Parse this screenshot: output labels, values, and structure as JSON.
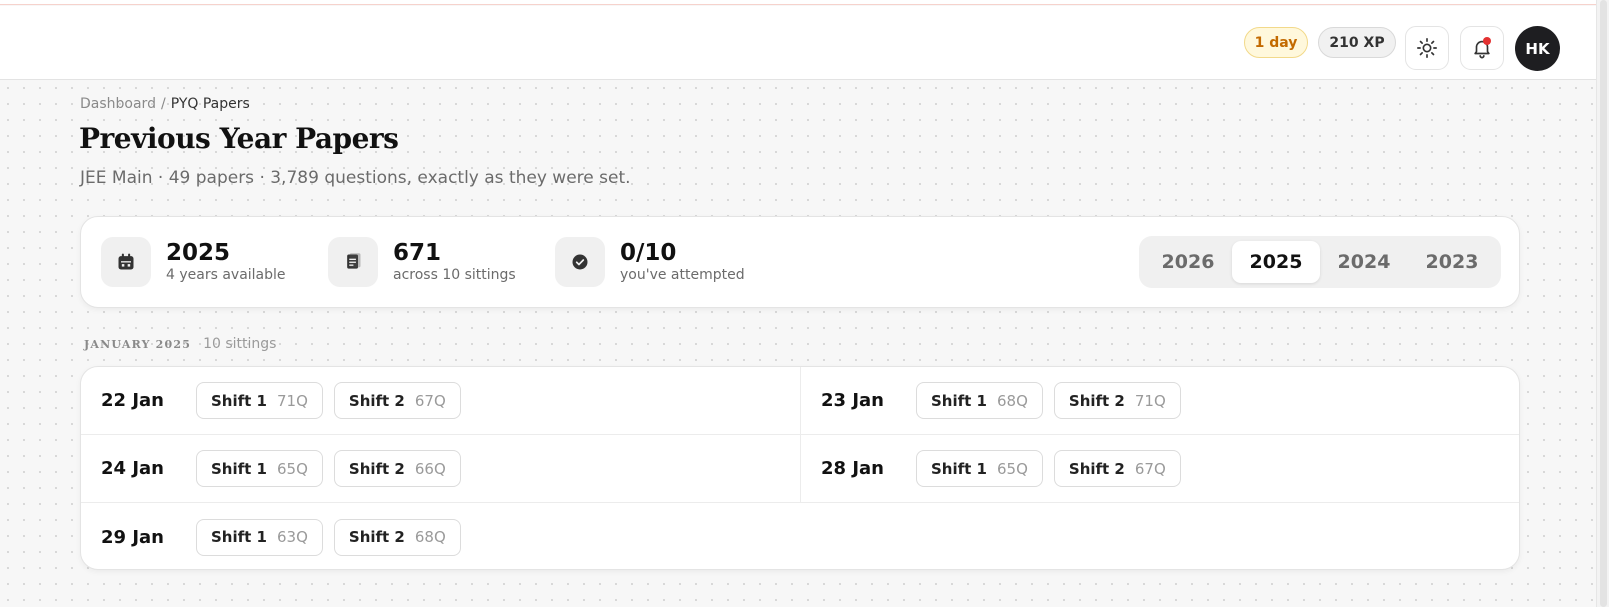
{
  "header": {
    "streak": "1 day",
    "xp": "210 XP",
    "avatar_initials": "HK",
    "accent_red": "#e33131"
  },
  "breadcrumb": {
    "parent": "Dashboard",
    "separator": "/",
    "current": "PYQ Papers"
  },
  "page": {
    "title": "Previous Year Papers",
    "subtitle": "JEE Main · 49 papers · 3,789 questions, exactly as they were set."
  },
  "stats": [
    {
      "icon": "calendar-icon",
      "value": "2025",
      "label": "4 years available"
    },
    {
      "icon": "document-icon",
      "value": "671",
      "label": "across 10 sittings"
    },
    {
      "icon": "check-circle-icon",
      "value": "0/10",
      "label": "you've attempted"
    }
  ],
  "years": {
    "options": [
      "2026",
      "2025",
      "2024",
      "2023"
    ],
    "selected": "2025"
  },
  "section": {
    "month": "JANUARY 2025",
    "count": "10 sittings"
  },
  "days": [
    {
      "date": "22 Jan",
      "shifts": [
        {
          "name": "Shift 1",
          "questions": "71Q"
        },
        {
          "name": "Shift 2",
          "questions": "67Q"
        }
      ]
    },
    {
      "date": "23 Jan",
      "shifts": [
        {
          "name": "Shift 1",
          "questions": "68Q"
        },
        {
          "name": "Shift 2",
          "questions": "71Q"
        }
      ]
    },
    {
      "date": "24 Jan",
      "shifts": [
        {
          "name": "Shift 1",
          "questions": "65Q"
        },
        {
          "name": "Shift 2",
          "questions": "66Q"
        }
      ]
    },
    {
      "date": "28 Jan",
      "shifts": [
        {
          "name": "Shift 1",
          "questions": "65Q"
        },
        {
          "name": "Shift 2",
          "questions": "67Q"
        }
      ]
    },
    {
      "date": "29 Jan",
      "shifts": [
        {
          "name": "Shift 1",
          "questions": "63Q"
        },
        {
          "name": "Shift 2",
          "questions": "68Q"
        }
      ]
    }
  ]
}
